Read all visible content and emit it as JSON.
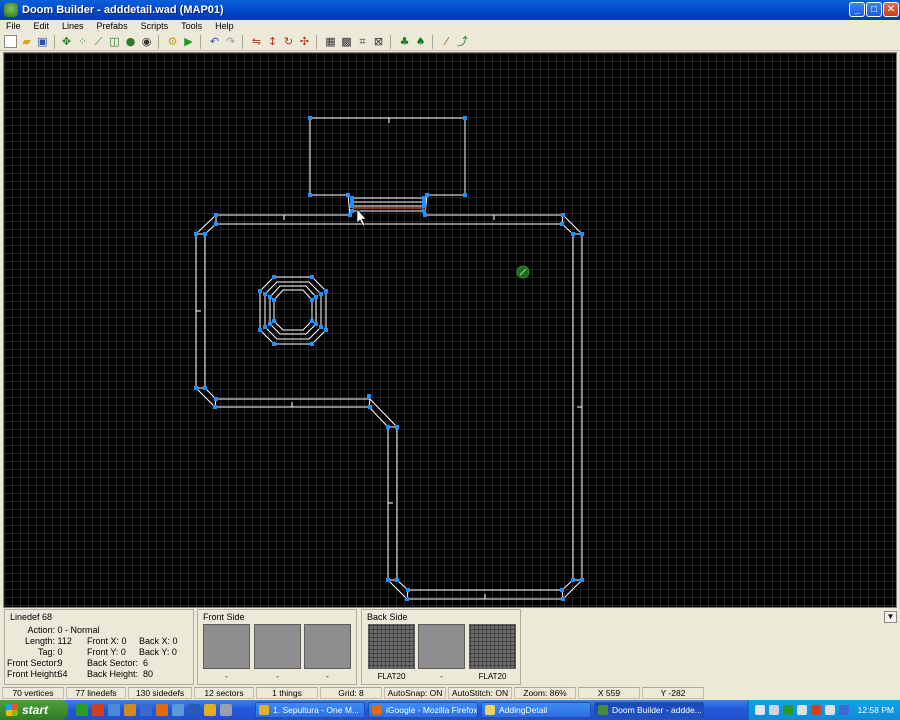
{
  "window": {
    "title": "Doom Builder - adddetail.wad (MAP01)",
    "minimize": "_",
    "maximize": "□",
    "close": "✕"
  },
  "menu": [
    "File",
    "Edit",
    "Lines",
    "Prefabs",
    "Scripts",
    "Tools",
    "Help"
  ],
  "toolbar": [
    "new-file-icon",
    "open-file-icon",
    "save-icon",
    "move-mode-icon",
    "vertices-mode-icon",
    "lines-mode-icon",
    "sectors-mode-icon",
    "things-mode-icon",
    "3d-mode-icon",
    "build-nodes-icon",
    "test-map-icon",
    "undo-icon",
    "redo-icon",
    "flip-icon",
    "rotate-icon",
    "resize-icon",
    "grid-icon",
    "snap-icon",
    "stitch-icon",
    "map-options-icon",
    "tree-icon",
    "tree-group-icon",
    "wand-icon",
    "curve-icon"
  ],
  "linedef": {
    "title": "Linedef 68",
    "action_label": "Action:",
    "action": "0 - Normal",
    "length_label": "Length:",
    "length": "112",
    "tag_label": "Tag:",
    "tag": "0",
    "front_sector_label": "Front Sector:",
    "front_sector": "9",
    "front_height_label": "Front Height:",
    "front_height": "64",
    "front_x_label": "Front X:",
    "front_x": "0",
    "front_y_label": "Front Y:",
    "front_y": "0",
    "back_sector_label": "Back Sector:",
    "back_sector": "6",
    "back_height_label": "Back Height:",
    "back_height": "80",
    "back_x_label": "Back X:",
    "back_x": "0",
    "back_y_label": "Back Y:",
    "back_y": "0"
  },
  "front_side": {
    "title": "Front Side",
    "upper": "-",
    "middle": "-",
    "lower": "-"
  },
  "back_side": {
    "title": "Back Side",
    "upper": "FLAT20",
    "middle": "-",
    "lower": "FLAT20"
  },
  "status": {
    "vertices": "70 vertices",
    "linedefs": "77 linedefs",
    "sidedefs": "130 sidedefs",
    "sectors": "12 sectors",
    "things": "1 things",
    "grid": "Grid: 8",
    "autosnap": "AutoSnap: ON",
    "autostitch": "AutoStitch: ON",
    "zoom": "Zoom: 86%",
    "x": "X 559",
    "y": "Y -282"
  },
  "taskbar": {
    "start": "start",
    "tasks": [
      {
        "label": "1. Sepultura - One M...",
        "active": false
      },
      {
        "label": "iGoogle - Mozilla Firefox",
        "active": false
      },
      {
        "label": "AddingDetail",
        "active": false
      },
      {
        "label": "Doom Builder - addde...",
        "active": true
      }
    ],
    "clock": "12:58 PM"
  },
  "colors": {
    "vertex": "#1e90ff",
    "line": "#ffffff",
    "grid": "#3c3c3c",
    "thing": "#2e8b2e",
    "selected": "#ff6a3d"
  }
}
